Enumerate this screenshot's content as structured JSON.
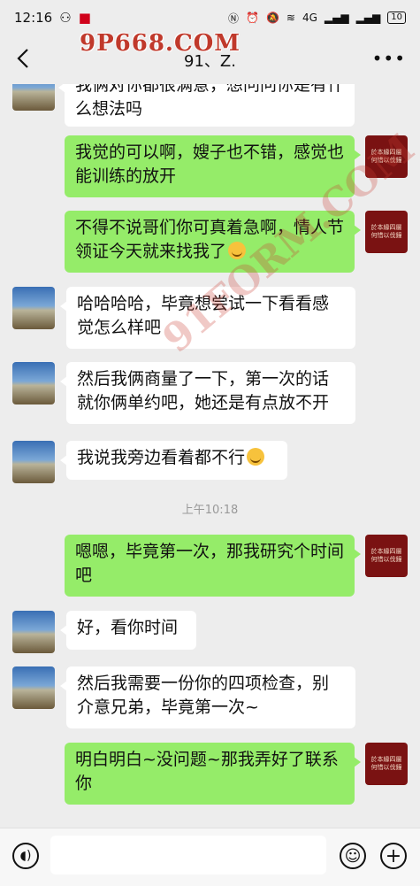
{
  "status": {
    "time": "12:16",
    "signal": "4G",
    "battery": "10"
  },
  "header": {
    "title": "91、Z."
  },
  "watermark": {
    "top_text": "9P668.COM",
    "diag_text": "91FORM.COM"
  },
  "avatars": {
    "right_text": "於本緣四層 何惜以伐鐘"
  },
  "messages": [
    {
      "side": "left",
      "text": "我俩对你都很满意，想问问你是有什么想法吗"
    },
    {
      "side": "right",
      "text": "我觉的可以啊，嫂子也不错，感觉也能训练的放开"
    },
    {
      "side": "right",
      "text": "不得不说哥们你可真着急啊，情人节领证今天就来找我了"
    },
    {
      "side": "left",
      "text": "哈哈哈哈，毕竟想尝试一下看看感觉怎么样吧"
    },
    {
      "side": "left",
      "text": "然后我俩商量了一下，第一次的话就你俩单约吧，她还是有点放不开"
    },
    {
      "side": "left",
      "text": "我说我旁边看着都不行"
    },
    {
      "timestamp": "上午10:18"
    },
    {
      "side": "right",
      "text": "嗯嗯，毕竟第一次，那我研究个时间吧"
    },
    {
      "side": "left",
      "text": "好，看你时间"
    },
    {
      "side": "left",
      "text": "然后我需要一份你的四项检查，别介意兄弟，毕竟第一次~"
    },
    {
      "side": "right",
      "text": "明白明白~没问题~那我弄好了联系你"
    }
  ]
}
